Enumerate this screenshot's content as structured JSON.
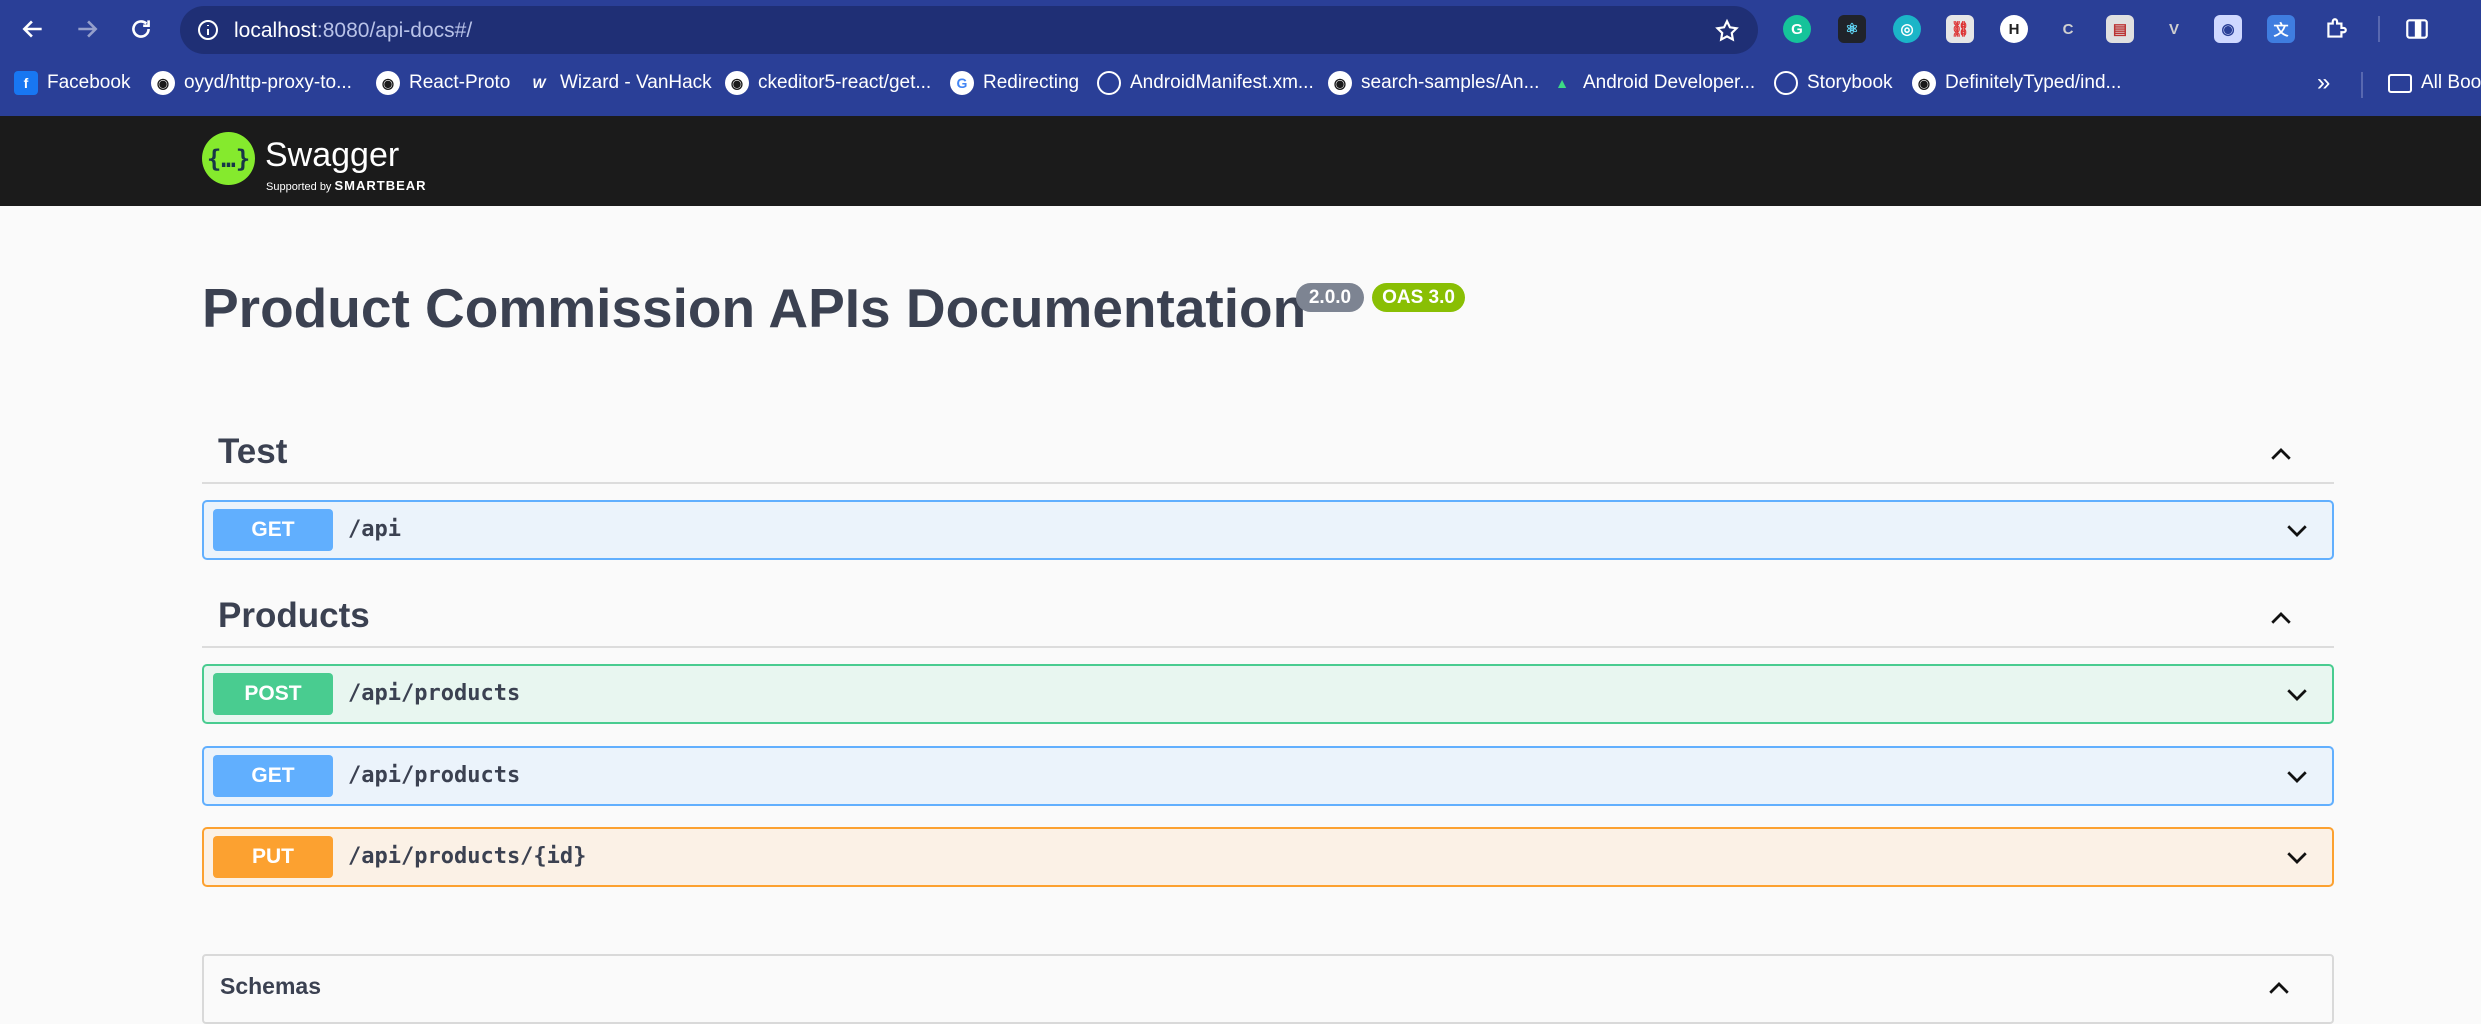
{
  "browser": {
    "url_host": "localhost",
    "url_rest": ":8080/api-docs#/",
    "bookmarks": [
      {
        "label": "Facebook",
        "icon": "facebook-icon"
      },
      {
        "label": "oyyd/http-proxy-to...",
        "icon": "github-icon"
      },
      {
        "label": "React-Proto",
        "icon": "github-icon"
      },
      {
        "label": "Wizard - VanHack",
        "icon": "wizard-icon"
      },
      {
        "label": "ckeditor5-react/get...",
        "icon": "github-icon"
      },
      {
        "label": "Redirecting",
        "icon": "google-icon"
      },
      {
        "label": "AndroidManifest.xm...",
        "icon": "globe-icon"
      },
      {
        "label": "search-samples/An...",
        "icon": "github-icon"
      },
      {
        "label": "Android Developer...",
        "icon": "android-icon"
      },
      {
        "label": "Storybook",
        "icon": "globe-icon"
      },
      {
        "label": "DefinitelyTyped/ind...",
        "icon": "github-icon"
      }
    ],
    "more_bookmarks": "»",
    "all_bookmarks": "All Boo"
  },
  "topbar": {
    "logo_text": "Swagger",
    "logo_sub_prefix": "Supported by",
    "logo_sub_brand": "SMARTBEAR"
  },
  "info": {
    "title": "Product Commission APIs Documentation",
    "version": "2.0.0",
    "oas": "OAS 3.0"
  },
  "tags": [
    {
      "name": "Test",
      "operations": [
        {
          "method": "GET",
          "path": "/api"
        }
      ]
    },
    {
      "name": "Products",
      "operations": [
        {
          "method": "POST",
          "path": "/api/products"
        },
        {
          "method": "GET",
          "path": "/api/products"
        },
        {
          "method": "PUT",
          "path": "/api/products/{id}"
        }
      ]
    }
  ],
  "schemas": {
    "label": "Schemas"
  },
  "colors": {
    "get": "#61affe",
    "post": "#49cc90",
    "put": "#fca130",
    "browser_chrome": "#2a3f97",
    "topbar": "#1b1b1b"
  }
}
